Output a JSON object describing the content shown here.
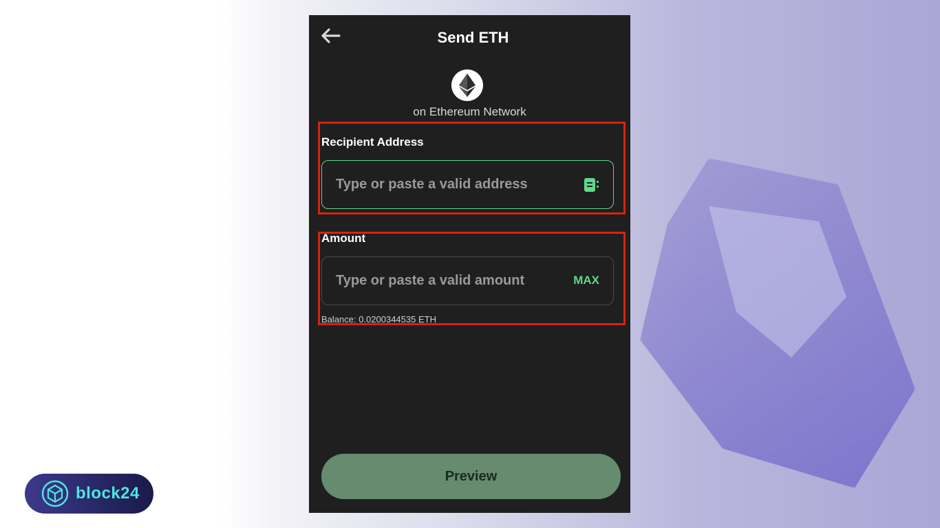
{
  "header": {
    "back_icon": "arrow-left-icon",
    "title": "Send ETH"
  },
  "token": {
    "icon": "ethereum-icon",
    "network": "on Ethereum Network"
  },
  "recipient": {
    "label": "Recipient Address",
    "placeholder": "Type or paste a valid address",
    "value": "",
    "address_book_icon": "address-book-icon"
  },
  "amount": {
    "label": "Amount",
    "placeholder": "Type or paste a valid amount",
    "value": "",
    "max_label": "MAX",
    "balance": "Balance: 0.0200344535 ETH"
  },
  "preview_label": "Preview",
  "brand": {
    "name": "block24",
    "icon": "cube-logo-icon"
  },
  "colors": {
    "accent": "#5fd98a",
    "highlight": "#d9230f",
    "panel_bg": "#1f1f1f",
    "button_bg": "#668b6e"
  }
}
